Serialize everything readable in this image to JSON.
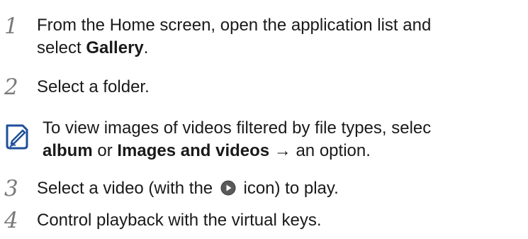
{
  "steps": [
    {
      "number": "1",
      "line1": "From the Home screen, open the application list and",
      "line2_prefix": "select ",
      "line2_bold": "Gallery",
      "line2_suffix": "."
    },
    {
      "number": "2",
      "text": "Select a folder."
    },
    {
      "number": "3",
      "prefix": "Select a video (with the",
      "suffix": "icon) to play."
    },
    {
      "number": "4",
      "text": "Control playback with the virtual keys."
    }
  ],
  "note": {
    "line1": "To view images of videos filtered by file types, selec",
    "line2_bold1": "album",
    "line2_mid": " or ",
    "line2_bold2": "Images and videos",
    "line2_suffix": " → an option.",
    "icon": "note-pencil-icon"
  },
  "icons": {
    "play": "play-circle-icon"
  },
  "colors": {
    "step_number": "#7a7a7a",
    "text": "#1a1a1a",
    "note_icon": "#1e4f9a",
    "play_icon": "#5a5a5a"
  }
}
